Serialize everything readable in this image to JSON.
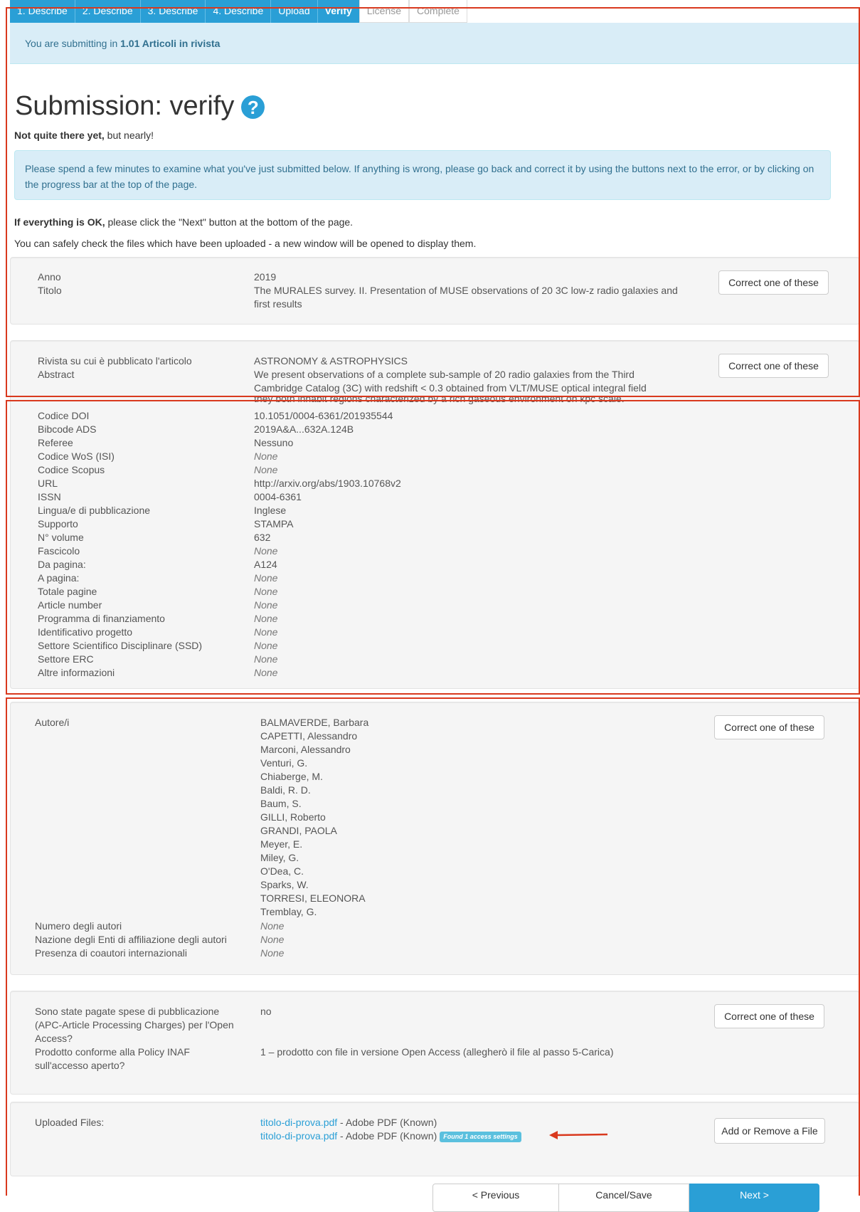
{
  "progress": {
    "steps": [
      "1. Describe",
      "2. Describe",
      "3. Describe",
      "4. Describe",
      "Upload",
      "Verify",
      "License",
      "Complete"
    ]
  },
  "banner": {
    "prefix": "You are submitting in ",
    "collection": "1.01 Articoli in rivista"
  },
  "page": {
    "title": "Submission: verify",
    "help_icon": "question-circle-icon",
    "subtitle_bold": "Not quite there yet,",
    "subtitle_rest": " but nearly!",
    "alert": "Please spend a few minutes to examine what you've just submitted below. If anything is wrong, please go back and correct it by using the buttons next to the error, or by clicking on the progress bar at the top of the page.",
    "ok_bold": "If everything is OK,",
    "ok_rest": " please click the \"Next\" button at the bottom of the page.",
    "files_note": "You can safely check the files which have been uploaded - a new window will be opened to display them."
  },
  "correct_label": "Correct one of these",
  "section1": {
    "labels": [
      "Anno",
      "Titolo"
    ],
    "anno": "2019",
    "titolo_l1": "The MURALES survey. II. Presentation of MUSE observations of 20 3C low-z radio galaxies and",
    "titolo_l2": "first results"
  },
  "section2": {
    "labels": [
      "Rivista su cui è pubblicato l'articolo",
      "Abstract"
    ],
    "rivista": "ASTRONOMY & ASTROPHYSICS",
    "abstract_l1": "We present observations of a complete sub-sample of 20 radio galaxies from the Third",
    "abstract_l2": "Cambridge Catalog (3C) with redshift < 0.3 obtained from VLT/MUSE optical integral field",
    "abstract_tail": "they both inhabit regions characterized by a rich gaseous environment on kpc scale."
  },
  "fields": [
    {
      "label": "Codice DOI",
      "value": "10.1051/0004-6361/201935544",
      "none": false
    },
    {
      "label": "Bibcode ADS",
      "value": "2019A&A...632A.124B",
      "none": false
    },
    {
      "label": "Referee",
      "value": "Nessuno",
      "none": false
    },
    {
      "label": "Codice WoS (ISI)",
      "value": "None",
      "none": true
    },
    {
      "label": "Codice Scopus",
      "value": "None",
      "none": true
    },
    {
      "label": "URL",
      "value": "http://arxiv.org/abs/1903.10768v2",
      "none": false
    },
    {
      "label": "ISSN",
      "value": "0004-6361",
      "none": false
    },
    {
      "label": "Lingua/e di pubblicazione",
      "value": "Inglese",
      "none": false
    },
    {
      "label": "Supporto",
      "value": "STAMPA",
      "none": false
    },
    {
      "label": "N° volume",
      "value": "632",
      "none": false
    },
    {
      "label": "Fascicolo",
      "value": "None",
      "none": true
    },
    {
      "label": "Da pagina:",
      "value": "A124",
      "none": false
    },
    {
      "label": "A pagina:",
      "value": "None",
      "none": true
    },
    {
      "label": "Totale pagine",
      "value": "None",
      "none": true
    },
    {
      "label": "Article number",
      "value": "None",
      "none": true
    },
    {
      "label": "Programma di finanziamento",
      "value": "None",
      "none": true
    },
    {
      "label": "Identificativo progetto",
      "value": "None",
      "none": true
    },
    {
      "label": "Settore Scientifico Disciplinare (SSD)",
      "value": "None",
      "none": true
    },
    {
      "label": "Settore ERC",
      "value": "None",
      "none": true
    },
    {
      "label": "Altre informazioni",
      "value": "None",
      "none": true
    }
  ],
  "authors_section": {
    "label": "Autore/i",
    "authors": [
      "BALMAVERDE, Barbara",
      "CAPETTI, Alessandro",
      "Marconi, Alessandro",
      "Venturi, G.",
      "Chiaberge, M.",
      "Baldi, R. D.",
      "Baum, S.",
      "GILLI, Roberto",
      "GRANDI, PAOLA",
      "Meyer, E.",
      "Miley, G.",
      "O'Dea, C.",
      "Sparks, W.",
      "TORRESI, ELEONORA",
      "Tremblay, G."
    ],
    "extra": [
      {
        "label": "Numero degli autori",
        "value": "None"
      },
      {
        "label": "Nazione degli Enti di affiliazione degli autori",
        "value": "None"
      },
      {
        "label": "Presenza di coautori internazionali",
        "value": "None"
      }
    ]
  },
  "apc_section": {
    "q1_lines": [
      "Sono state pagate spese di pubblicazione",
      "(APC-Article Processing Charges) per l'Open",
      "Access?"
    ],
    "a1": "no",
    "q2_lines": [
      "Prodotto conforme alla Policy INAF",
      "sull'accesso aperto?"
    ],
    "a2": "1 – prodotto con file in versione Open Access (allegherò il file al passo  5-Carica)"
  },
  "files_section": {
    "label": "Uploaded Files:",
    "files": [
      {
        "name": "titolo-di-prova.pdf",
        "desc": " - Adobe PDF (Known)"
      },
      {
        "name": "titolo-di-prova.pdf",
        "desc": " - Adobe PDF (Known)",
        "badge": "Found 1 access settings"
      }
    ],
    "button": "Add or Remove a File"
  },
  "nav": {
    "previous": "< Previous",
    "cancel": "Cancel/Save",
    "next": "Next >"
  },
  "colors": {
    "accent": "#2a9fd6",
    "annotation": "#d9391e",
    "info_bg": "#d9edf7"
  }
}
